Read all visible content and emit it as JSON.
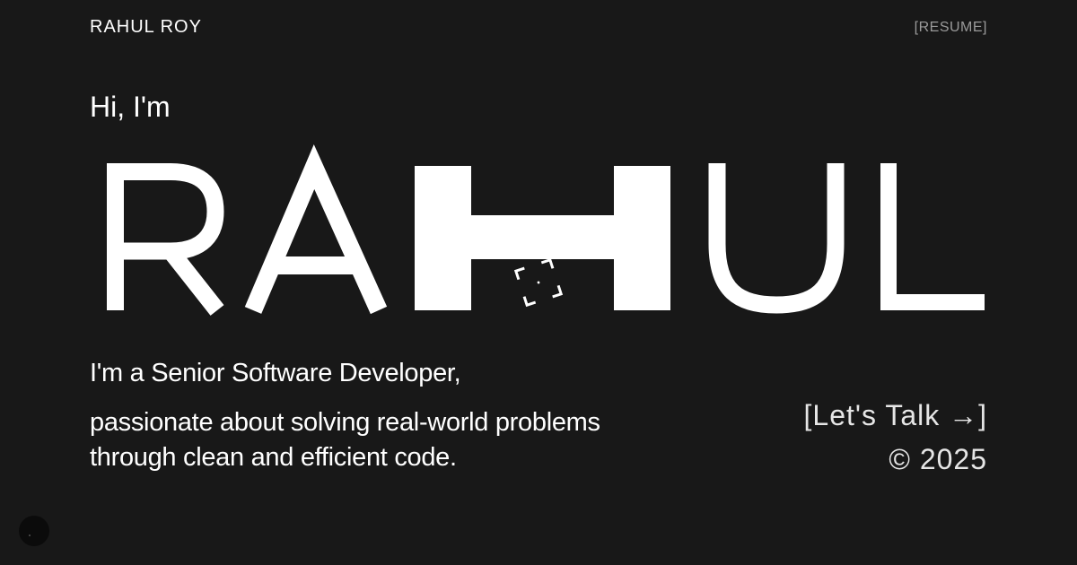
{
  "header": {
    "logo_text": "RAHUL ROY",
    "resume_label": "[RESUME]"
  },
  "hero": {
    "greeting": "Hi, I'm",
    "big_name": "RAHUL",
    "letters": [
      "R",
      "A",
      "H",
      "U",
      "L"
    ],
    "tagline": "I'm a Senior Software Developer,",
    "description": "passionate about solving real-world problems through clean and efficient code."
  },
  "cta": {
    "label": "[Let's Talk →]"
  },
  "footer": {
    "copyright": "© 2025"
  },
  "icons": {
    "focus_icon": "focus-corners-icon",
    "theme_toggle": "theme-toggle-icon"
  },
  "colors": {
    "background": "#181818",
    "text": "#ffffff",
    "muted": "#9a9a9a"
  }
}
